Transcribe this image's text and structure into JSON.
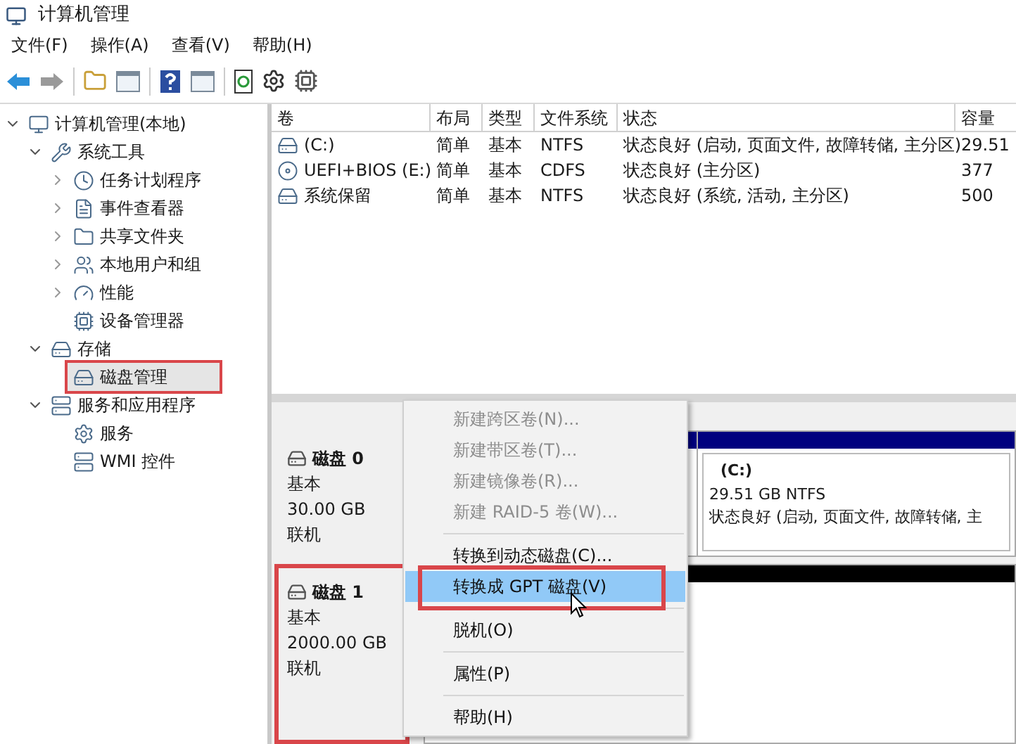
{
  "window": {
    "title": "计算机管理"
  },
  "menu_bar": [
    "文件(F)",
    "操作(A)",
    "查看(V)",
    "帮助(H)"
  ],
  "tree": [
    {
      "label": "计算机管理(本地)",
      "expanded": true,
      "selected": false,
      "highlighted": false,
      "children": [
        {
          "label": "系统工具",
          "expanded": true,
          "selected": false,
          "highlighted": false,
          "children": [
            {
              "label": "任务计划程序",
              "expanded": false,
              "selected": false,
              "highlighted": false
            },
            {
              "label": "事件查看器",
              "expanded": false,
              "selected": false,
              "highlighted": false
            },
            {
              "label": "共享文件夹",
              "expanded": false,
              "selected": false,
              "highlighted": false
            },
            {
              "label": "本地用户和组",
              "expanded": false,
              "selected": false,
              "highlighted": false
            },
            {
              "label": "性能",
              "expanded": false,
              "selected": false,
              "highlighted": false
            },
            {
              "label": "设备管理器",
              "selected": false,
              "highlighted": false
            }
          ]
        },
        {
          "label": "存储",
          "expanded": true,
          "selected": false,
          "highlighted": false,
          "children": [
            {
              "label": "磁盘管理",
              "selected": true,
              "highlighted": true
            }
          ]
        },
        {
          "label": "服务和应用程序",
          "expanded": true,
          "selected": false,
          "highlighted": false,
          "children": [
            {
              "label": "服务",
              "selected": false,
              "highlighted": false
            },
            {
              "label": "WMI 控件",
              "selected": false,
              "highlighted": false
            }
          ]
        }
      ]
    }
  ],
  "volume_table": {
    "columns": [
      "卷",
      "布局",
      "类型",
      "文件系统",
      "状态",
      "容量"
    ],
    "rows": [
      {
        "kind": "drive",
        "cells": [
          "(C:)",
          "简单",
          "基本",
          "NTFS",
          "状态良好 (启动, 页面文件, 故障转储, 主分区)",
          "29.51"
        ]
      },
      {
        "kind": "cd",
        "cells": [
          "UEFI+BIOS (E:)",
          "简单",
          "基本",
          "CDFS",
          "状态良好 (主分区)",
          "377"
        ]
      },
      {
        "kind": "drive",
        "cells": [
          "系统保留",
          "简单",
          "基本",
          "NTFS",
          "状态良好 (系统, 活动, 主分区)",
          "500"
        ]
      }
    ]
  },
  "disks": [
    {
      "kind": "partitioned",
      "name": "磁盘 0",
      "type": "基本",
      "size": "30.00 GB",
      "status": "联机",
      "highlighted": false,
      "partitions": [
        {
          "name": "(C:)",
          "size": "29.51 GB NTFS",
          "status": "状态良好 (启动, 页面文件, 故障转储, 主"
        }
      ]
    },
    {
      "kind": "unallocated",
      "name": "磁盘 1",
      "type": "基本",
      "size": "2000.00 GB",
      "status": "联机",
      "highlighted": true
    }
  ],
  "context_menu": [
    {
      "kind": "item",
      "label": "新建跨区卷(N)...",
      "disabled": true,
      "selected": false,
      "highlighted": false
    },
    {
      "kind": "item",
      "label": "新建带区卷(T)...",
      "disabled": true,
      "selected": false,
      "highlighted": false
    },
    {
      "kind": "item",
      "label": "新建镜像卷(R)...",
      "disabled": true,
      "selected": false,
      "highlighted": false
    },
    {
      "kind": "item",
      "label": "新建 RAID-5 卷(W)...",
      "disabled": true,
      "selected": false,
      "highlighted": false
    },
    {
      "kind": "separator"
    },
    {
      "kind": "item",
      "label": "转换到动态磁盘(C)...",
      "disabled": false,
      "selected": false,
      "highlighted": false
    },
    {
      "kind": "item",
      "label": "转换成 GPT 磁盘(V)",
      "disabled": false,
      "selected": true,
      "highlighted": true
    },
    {
      "kind": "separator"
    },
    {
      "kind": "item",
      "label": "脱机(O)",
      "disabled": false,
      "selected": false,
      "highlighted": false
    },
    {
      "kind": "separator"
    },
    {
      "kind": "item",
      "label": "属性(P)",
      "disabled": false,
      "selected": false,
      "highlighted": false
    },
    {
      "kind": "separator"
    },
    {
      "kind": "item",
      "label": "帮助(H)",
      "disabled": false,
      "selected": false,
      "highlighted": false
    }
  ]
}
